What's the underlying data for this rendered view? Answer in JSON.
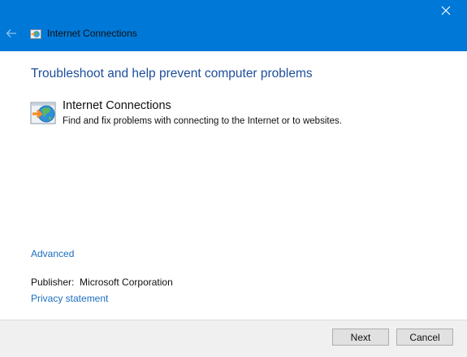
{
  "window": {
    "title": "Internet Connections"
  },
  "content": {
    "heading": "Troubleshoot and help prevent computer problems",
    "tool": {
      "name": "Internet Connections",
      "description": "Find and fix problems with connecting to the Internet or to websites."
    },
    "advanced_link": "Advanced",
    "publisher_label": "Publisher:",
    "publisher_value": "Microsoft Corporation",
    "privacy_link": "Privacy statement"
  },
  "footer": {
    "next_label": "Next",
    "cancel_label": "Cancel"
  },
  "colors": {
    "titlebar": "#0078d7",
    "heading": "#1e4e9b",
    "link": "#1a6ec2"
  },
  "icons": {
    "close": "close-icon",
    "back": "back-arrow-icon",
    "app": "internet-connections-icon"
  }
}
